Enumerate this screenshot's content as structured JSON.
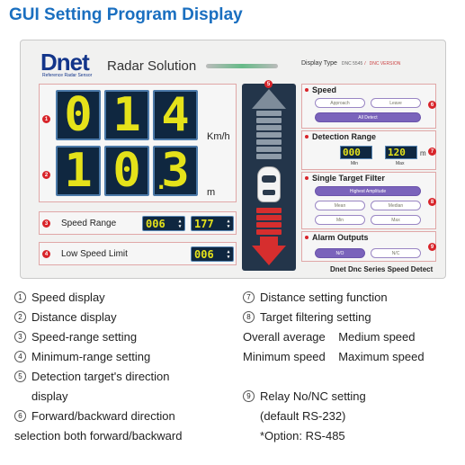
{
  "page_title": "GUI Setting Program Display",
  "app": {
    "brand": "Dnet",
    "brand_sub": "Reference Radar Sensor",
    "name": "Radar Solution",
    "display_type_label": "Display Type",
    "display_type_options": [
      "DNC 5545",
      "DNC VERSION"
    ]
  },
  "speed_display": {
    "digits": [
      "0",
      "1",
      "4"
    ],
    "unit": "Km/h",
    "badge": "1"
  },
  "distance_display": {
    "digits": [
      "1",
      "0",
      "3"
    ],
    "decimal_point": ".",
    "unit": "m",
    "badge": "2"
  },
  "speed_range": {
    "label": "Speed Range",
    "min": "006",
    "max": "177",
    "badge": "3"
  },
  "low_speed_limit": {
    "label": "Low Speed Limit",
    "value": "006",
    "badge": "4"
  },
  "direction_panel": {
    "badge": "5"
  },
  "speed_section": {
    "title": "Speed",
    "approach": "Approach",
    "leave": "Leave",
    "all_detect": "All Detect",
    "badge": "6"
  },
  "detection_range": {
    "title": "Detection Range",
    "min": "000",
    "max": "120",
    "unit": "m",
    "min_label": "Min",
    "max_label": "Max",
    "badge": "7"
  },
  "single_target_filter": {
    "title": "Single Target Filter",
    "highest": "Highest Amplitude",
    "mean": "Mean",
    "median": "Median",
    "min": "Min",
    "max": "Max",
    "badge": "8"
  },
  "alarm_outputs": {
    "title": "Alarm Outputs",
    "no": "N/O",
    "nc": "N/C",
    "badge": "9"
  },
  "footer_text": "Dnet Dnc Series Speed Detect",
  "legend_left": [
    {
      "num": "1",
      "text": "Speed display"
    },
    {
      "num": "2",
      "text": "Distance display"
    },
    {
      "num": "3",
      "text": "Speed-range setting"
    },
    {
      "num": "4",
      "text": "Minimum-range setting"
    },
    {
      "num": "5",
      "text": "Detection target's direction"
    },
    {
      "num": "",
      "text": "display"
    },
    {
      "num": "6",
      "text": "Forward/backward direction"
    },
    {
      "num": "",
      "text": "selection both forward/backward"
    }
  ],
  "legend_right": [
    {
      "num": "7",
      "text": "Distance setting function"
    },
    {
      "num": "8",
      "text": "Target filtering setting"
    },
    {
      "num": "",
      "text": "Overall average    Medium speed"
    },
    {
      "num": "",
      "text": "Minimum speed    Maximum speed"
    },
    {
      "num": "",
      "text": ""
    },
    {
      "num": "9",
      "text": "Relay No/NC setting"
    },
    {
      "num": "",
      "text": "(default RS-232)"
    },
    {
      "num": "",
      "text": "*Option: RS-485"
    }
  ]
}
